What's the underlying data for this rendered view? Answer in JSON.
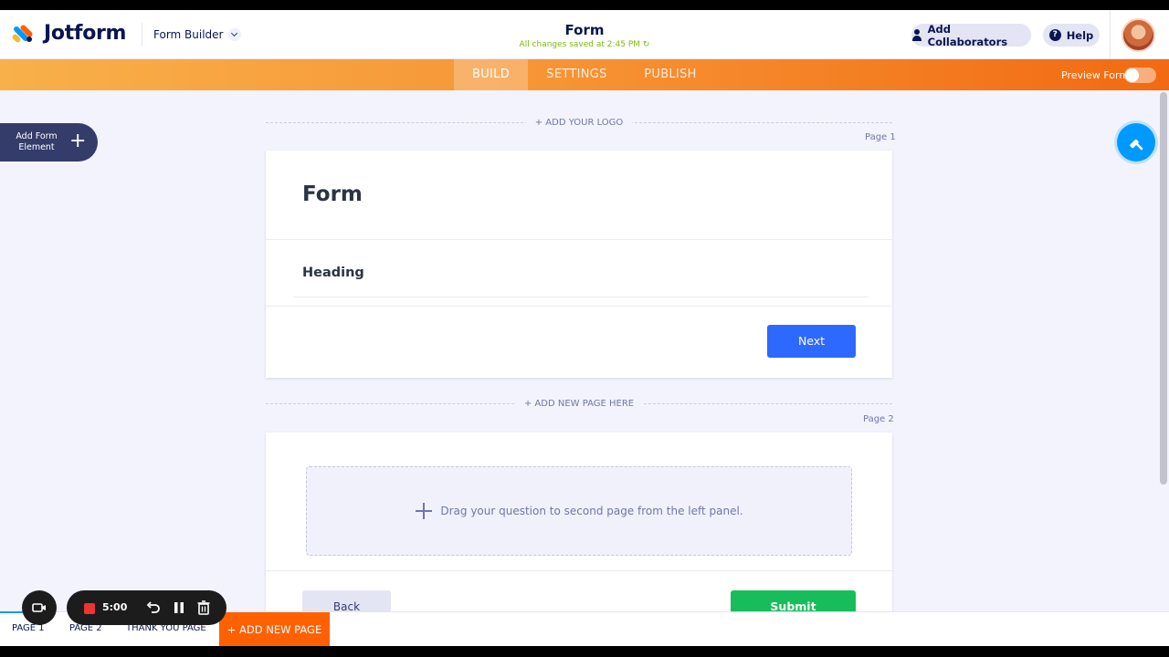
{
  "app": {
    "brand": "Jotform",
    "builder_menu": "Form Builder",
    "form_title": "Form",
    "save_status": "All changes saved at 2:45 PM",
    "add_collaborators": "Add Collaborators",
    "help": "Help"
  },
  "nav": {
    "tabs": [
      {
        "label": "BUILD",
        "active": true
      },
      {
        "label": "SETTINGS",
        "active": false
      },
      {
        "label": "PUBLISH",
        "active": false
      }
    ],
    "preview_label": "Preview Form",
    "preview_enabled": false
  },
  "sidebar": {
    "add_element_label": "Add Form Element"
  },
  "canvas": {
    "add_logo": "+ ADD YOUR LOGO",
    "add_new_page_here": "+ ADD NEW PAGE HERE",
    "page1": {
      "label": "Page 1",
      "title": "Form",
      "heading": "Heading",
      "next_button": "Next"
    },
    "page2": {
      "label": "Page 2",
      "dropzone_text": "Drag your question to second page from the left panel.",
      "back_button": "Back",
      "submit_button": "Submit"
    }
  },
  "pagebar": {
    "tabs": [
      "PAGE 1",
      "PAGE 2",
      "THANK YOU PAGE"
    ],
    "add_page": "+ ADD NEW PAGE"
  },
  "recorder": {
    "time": "5:00"
  },
  "colors": {
    "accent_orange": "#ff6100",
    "next_blue": "#2e69ff",
    "submit_green": "#18bd5b",
    "navy": "#0a1551"
  }
}
